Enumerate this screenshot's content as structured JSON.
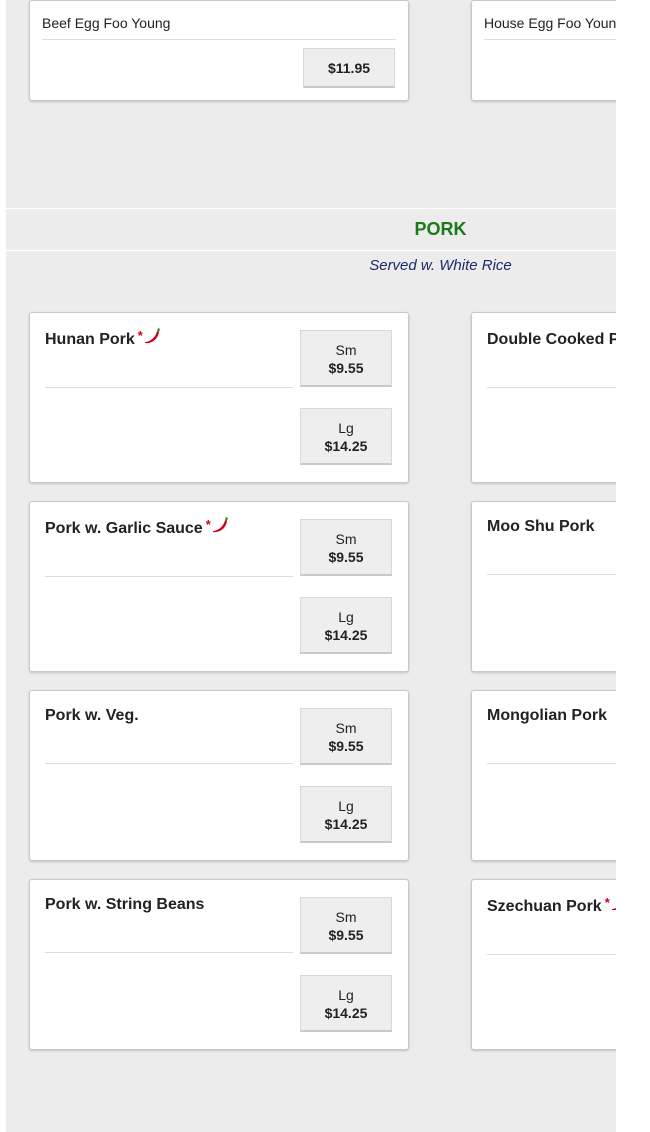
{
  "egg_foo_young": {
    "items": [
      {
        "name": "Beef Egg Foo Young",
        "price": "$11.95"
      },
      {
        "name": "House Egg Foo Young"
      }
    ]
  },
  "section": {
    "title": "PORK",
    "subtitle": "Served w. White Rice"
  },
  "pork": {
    "left": [
      {
        "name": "Hunan Pork",
        "spicy_mark": "*",
        "sizes": [
          {
            "size": "Sm",
            "price": "$9.55"
          },
          {
            "size": "Lg",
            "price": "$14.25"
          }
        ]
      },
      {
        "name": "Pork w. Garlic Sauce",
        "spicy_mark": "*",
        "sizes": [
          {
            "size": "Sm",
            "price": "$9.55"
          },
          {
            "size": "Lg",
            "price": "$14.25"
          }
        ]
      },
      {
        "name": "Pork w. Veg.",
        "sizes": [
          {
            "size": "Sm",
            "price": "$9.55"
          },
          {
            "size": "Lg",
            "price": "$14.25"
          }
        ]
      },
      {
        "name": "Pork w. String Beans",
        "sizes": [
          {
            "size": "Sm",
            "price": "$9.55"
          },
          {
            "size": "Lg",
            "price": "$14.25"
          }
        ]
      }
    ],
    "right": [
      {
        "name": "Double Cooked Pork"
      },
      {
        "name": "Moo Shu Pork"
      },
      {
        "name": "Mongolian Pork"
      },
      {
        "name": "Szechuan Pork",
        "spicy_mark": "*"
      }
    ]
  },
  "colors": {
    "section_title": "#1a7a1a",
    "subtitle": "#1c2a6b",
    "spicy": "#d0021b",
    "background": "#ececec"
  },
  "icons": {
    "spicy": "chili-pepper-icon"
  }
}
